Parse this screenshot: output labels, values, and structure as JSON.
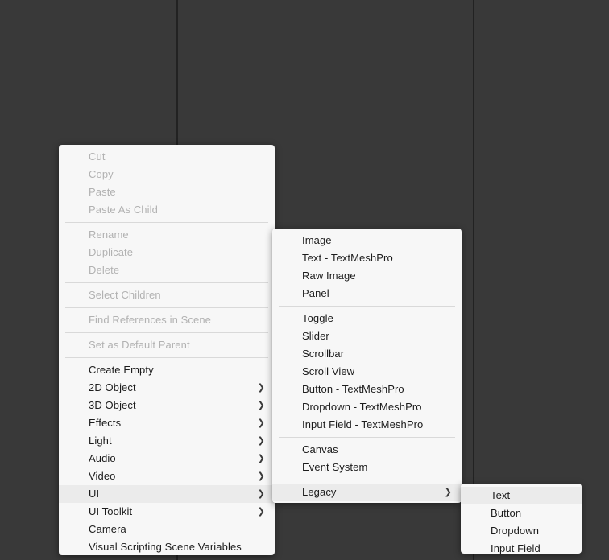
{
  "window": {
    "background_color": "#393939",
    "divider_color": "#222222"
  },
  "theme": {
    "menu_background": "#f7f7f7",
    "menu_text": "#1c1c1c",
    "menu_text_disabled": "#b2b2b2",
    "menu_highlight": "#ebebeb",
    "menu_separator": "#d9d9d9"
  },
  "icons": {
    "submenu_arrow": "❯"
  },
  "menus": {
    "root": {
      "name": "hierarchy-context-menu",
      "items": [
        {
          "label": "Cut",
          "disabled": true,
          "submenu": false,
          "highlighted": false
        },
        {
          "label": "Copy",
          "disabled": true,
          "submenu": false,
          "highlighted": false
        },
        {
          "label": "Paste",
          "disabled": true,
          "submenu": false,
          "highlighted": false
        },
        {
          "label": "Paste As Child",
          "disabled": true,
          "submenu": false,
          "highlighted": false
        },
        {
          "separator": true
        },
        {
          "label": "Rename",
          "disabled": true,
          "submenu": false,
          "highlighted": false
        },
        {
          "label": "Duplicate",
          "disabled": true,
          "submenu": false,
          "highlighted": false
        },
        {
          "label": "Delete",
          "disabled": true,
          "submenu": false,
          "highlighted": false
        },
        {
          "separator": true
        },
        {
          "label": "Select Children",
          "disabled": true,
          "submenu": false,
          "highlighted": false
        },
        {
          "separator": true
        },
        {
          "label": "Find References in Scene",
          "disabled": true,
          "submenu": false,
          "highlighted": false
        },
        {
          "separator": true
        },
        {
          "label": "Set as Default Parent",
          "disabled": true,
          "submenu": false,
          "highlighted": false
        },
        {
          "separator": true
        },
        {
          "label": "Create Empty",
          "disabled": false,
          "submenu": false,
          "highlighted": false
        },
        {
          "label": "2D Object",
          "disabled": false,
          "submenu": true,
          "highlighted": false
        },
        {
          "label": "3D Object",
          "disabled": false,
          "submenu": true,
          "highlighted": false
        },
        {
          "label": "Effects",
          "disabled": false,
          "submenu": true,
          "highlighted": false
        },
        {
          "label": "Light",
          "disabled": false,
          "submenu": true,
          "highlighted": false
        },
        {
          "label": "Audio",
          "disabled": false,
          "submenu": true,
          "highlighted": false
        },
        {
          "label": "Video",
          "disabled": false,
          "submenu": true,
          "highlighted": false
        },
        {
          "label": "UI",
          "disabled": false,
          "submenu": true,
          "highlighted": true
        },
        {
          "label": "UI Toolkit",
          "disabled": false,
          "submenu": true,
          "highlighted": false
        },
        {
          "label": "Camera",
          "disabled": false,
          "submenu": false,
          "highlighted": false
        },
        {
          "label": "Visual Scripting Scene Variables",
          "disabled": false,
          "submenu": false,
          "highlighted": false
        }
      ]
    },
    "ui": {
      "name": "ui-submenu",
      "items": [
        {
          "label": "Image",
          "disabled": false,
          "submenu": false,
          "highlighted": false
        },
        {
          "label": "Text - TextMeshPro",
          "disabled": false,
          "submenu": false,
          "highlighted": false
        },
        {
          "label": "Raw Image",
          "disabled": false,
          "submenu": false,
          "highlighted": false
        },
        {
          "label": "Panel",
          "disabled": false,
          "submenu": false,
          "highlighted": false
        },
        {
          "separator": true
        },
        {
          "label": "Toggle",
          "disabled": false,
          "submenu": false,
          "highlighted": false
        },
        {
          "label": "Slider",
          "disabled": false,
          "submenu": false,
          "highlighted": false
        },
        {
          "label": "Scrollbar",
          "disabled": false,
          "submenu": false,
          "highlighted": false
        },
        {
          "label": "Scroll View",
          "disabled": false,
          "submenu": false,
          "highlighted": false
        },
        {
          "label": "Button - TextMeshPro",
          "disabled": false,
          "submenu": false,
          "highlighted": false
        },
        {
          "label": "Dropdown - TextMeshPro",
          "disabled": false,
          "submenu": false,
          "highlighted": false
        },
        {
          "label": "Input Field - TextMeshPro",
          "disabled": false,
          "submenu": false,
          "highlighted": false
        },
        {
          "separator": true
        },
        {
          "label": "Canvas",
          "disabled": false,
          "submenu": false,
          "highlighted": false
        },
        {
          "label": "Event System",
          "disabled": false,
          "submenu": false,
          "highlighted": false
        },
        {
          "separator": true
        },
        {
          "label": "Legacy",
          "disabled": false,
          "submenu": true,
          "highlighted": true
        }
      ]
    },
    "legacy": {
      "name": "legacy-submenu",
      "items": [
        {
          "label": "Text",
          "disabled": false,
          "submenu": false,
          "highlighted": true
        },
        {
          "label": "Button",
          "disabled": false,
          "submenu": false,
          "highlighted": false
        },
        {
          "label": "Dropdown",
          "disabled": false,
          "submenu": false,
          "highlighted": false
        },
        {
          "label": "Input Field",
          "disabled": false,
          "submenu": false,
          "highlighted": false
        }
      ]
    }
  }
}
